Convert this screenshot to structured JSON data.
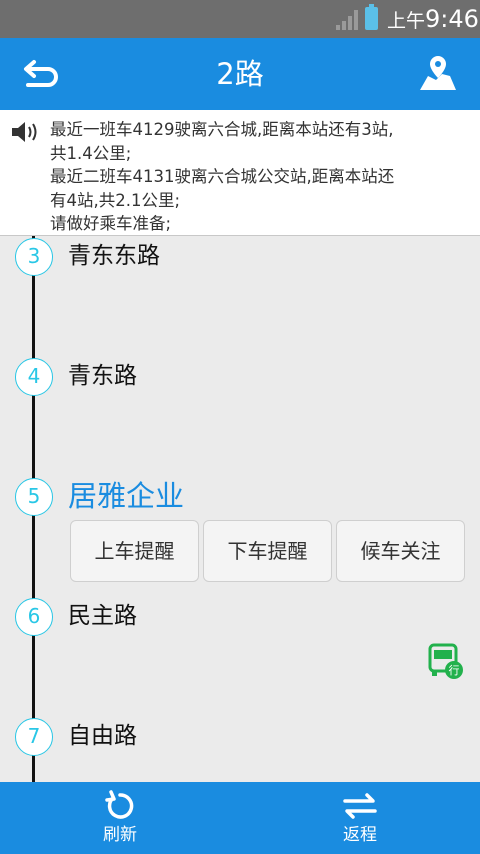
{
  "status_bar": {
    "ampm": "上午",
    "time": "9:46",
    "icons": [
      "signal-icon",
      "battery-icon"
    ]
  },
  "header": {
    "title": "2路",
    "icons": [
      "back-icon",
      "map-icon"
    ]
  },
  "notice": {
    "icon": "speaker-icon",
    "text": "最近一班车4129驶离六合城,距离本站还有3站,\n共1.4公里;\n最近二班车4131驶离六合城公交站,距离本站还\n有4站,共2.1公里;\n请做好乘车准备;"
  },
  "stops": [
    {
      "number": "3",
      "name": "青东东路"
    },
    {
      "number": "4",
      "name": "青东路"
    },
    {
      "number": "5",
      "name": "居雅企业",
      "current": true
    },
    {
      "number": "6",
      "name": "民主路"
    },
    {
      "number": "7",
      "name": "自由路"
    }
  ],
  "stop_actions": {
    "board_alert": "上车提醒",
    "alight_alert": "下车提醒",
    "watch_wait": "候车关注"
  },
  "bus_marker": {
    "label": "行",
    "icon": "bus-icon"
  },
  "bottom_bar": {
    "refresh": "刷新",
    "reverse": "返程",
    "icons": [
      "refresh-icon",
      "swap-icon"
    ]
  },
  "colors": {
    "primary": "#1a8ce0",
    "stop_ring": "#29c7e6",
    "bus_green": "#22b14c",
    "status_bar": "#6e6e6e"
  }
}
